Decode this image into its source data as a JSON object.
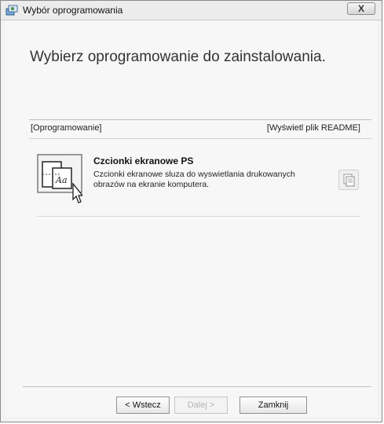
{
  "window": {
    "title": "Wybór oprogramowania",
    "close_label": "X"
  },
  "main": {
    "heading": "Wybierz oprogramowanie do zainstalowania.",
    "columns": {
      "left": "[Oprogramowanie]",
      "right": "[Wyświetl plik README]"
    },
    "items": [
      {
        "title": "Czcionki ekranowe PS",
        "description": "Czcionki ekranowe sluza do wyswietlania drukowanych obrazów na ekranie komputera.",
        "icon": "font-file-icon",
        "readme_icon": "document-icon"
      }
    ]
  },
  "footer": {
    "back_label": "< Wstecz",
    "next_label": "Dalej >",
    "close_label": "Zamknij"
  }
}
